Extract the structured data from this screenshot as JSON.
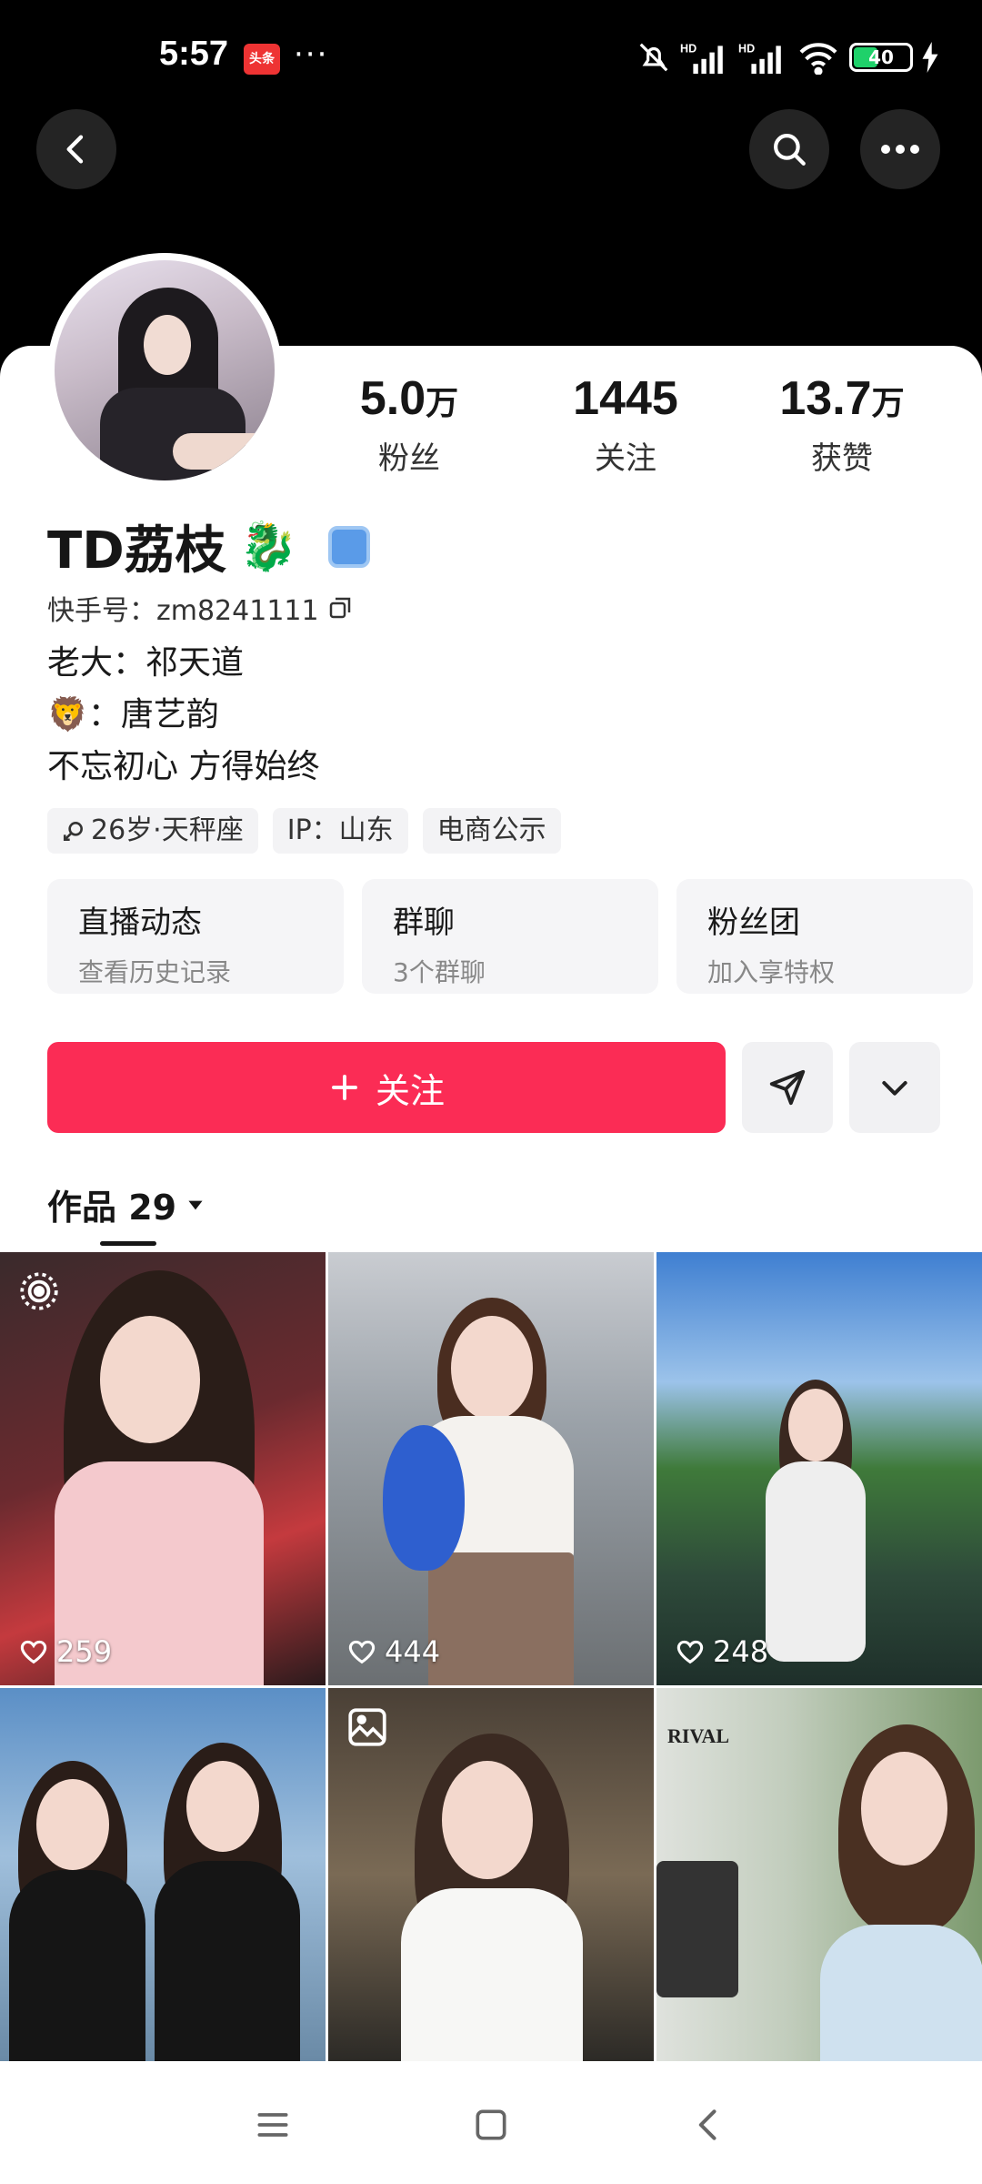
{
  "status_bar": {
    "time": "5:57",
    "app_badge": "头条",
    "more": "···",
    "battery": "40"
  },
  "profile": {
    "name": "TD荔枝",
    "name_emoji": "🐉",
    "uid_label": "快手号：zm8241111",
    "bio": [
      "老大：祁天道",
      "🦁：唐艺韵",
      "不忘初心 方得始终"
    ],
    "stats": [
      {
        "value": "5.0",
        "unit": "万",
        "label": "粉丝"
      },
      {
        "value": "1445",
        "unit": "",
        "label": "关注"
      },
      {
        "value": "13.7",
        "unit": "万",
        "label": "获赞"
      }
    ],
    "tags": [
      "26岁·天秤座",
      "IP：山东",
      "电商公示"
    ],
    "cards": [
      {
        "title": "直播动态",
        "sub": "查看历史记录"
      },
      {
        "title": "群聊",
        "sub": "3个群聊"
      },
      {
        "title": "粉丝团",
        "sub": "加入享特权"
      }
    ],
    "follow_label": "关注",
    "works_label": "作品 29"
  },
  "works": [
    {
      "likes": "259"
    },
    {
      "likes": "444"
    },
    {
      "likes": "248"
    },
    {
      "likes": ""
    },
    {
      "likes": ""
    },
    {
      "likes": ""
    }
  ],
  "thumb_text": {
    "rival": "RIVAL"
  },
  "colors": {
    "accent": "#fb2c55",
    "background": "#ffffff"
  }
}
